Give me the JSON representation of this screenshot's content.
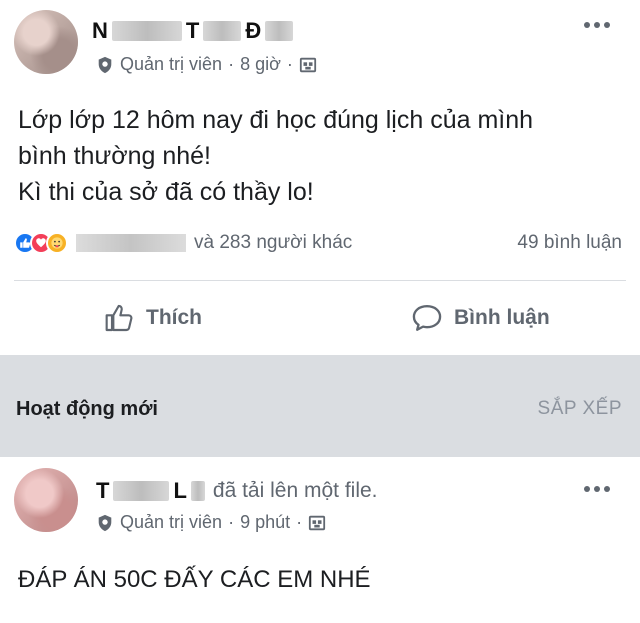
{
  "post1": {
    "author_initial_1": "N",
    "author_initial_2": "T",
    "author_initial_3": "Đ",
    "role": "Quản trị viên",
    "separator": "·",
    "time": "8 giờ",
    "text_lines": [
      "Lớp lớp 12 hôm nay đi học đúng lịch của mình",
      "bình thường nhé!",
      "Kì thi của sở đã có thầy lo!"
    ],
    "reactions_others": "và 283 người khác",
    "comments_count": "49 bình luận",
    "like_label": "Thích",
    "comment_label": "Bình luận"
  },
  "section": {
    "title": "Hoạt động mới",
    "sort_label": "SẮP XẾP"
  },
  "post2": {
    "author_initial_1": "T",
    "author_initial_2": "L",
    "action_text": "đã tải lên một file.",
    "role": "Quản trị viên",
    "separator": "·",
    "time": "9 phút",
    "text": "ĐÁP ÁN 50C ĐẤY CÁC EM NHÉ"
  },
  "colors": {
    "like_blue": "#1877f2",
    "love_red": "#f33e58",
    "care_yellow": "#f7b125",
    "muted_text": "#606770",
    "section_bg": "#dadde1"
  },
  "icons": {
    "admin": "shield-icon",
    "group": "group-icon",
    "more": "more-options-icon",
    "like": "thumbs-up-icon",
    "comment": "comment-bubble-icon"
  }
}
